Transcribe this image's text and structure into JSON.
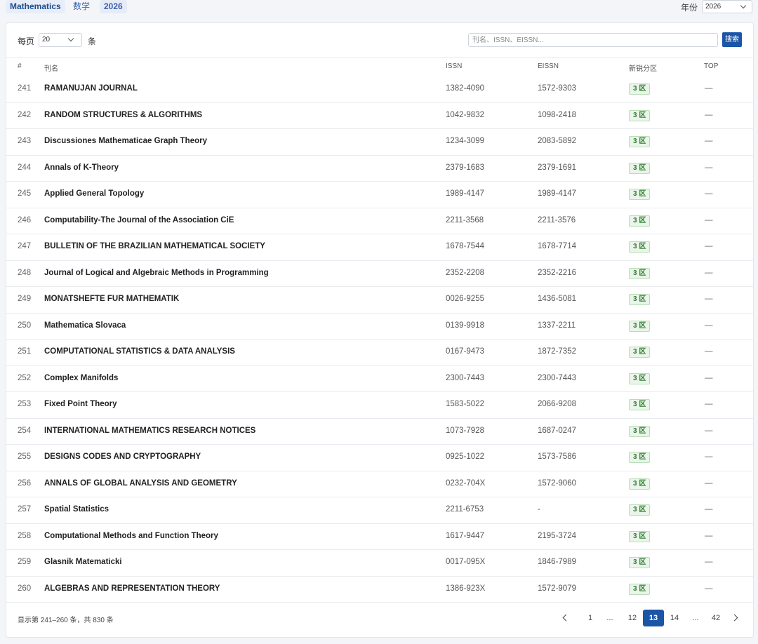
{
  "tags": [
    "Mathematics",
    "数学",
    "2026"
  ],
  "year": {
    "label": "年份",
    "selected": "2026"
  },
  "perpage": {
    "prefix": "每页",
    "value": "20",
    "suffix": "条"
  },
  "search": {
    "placeholder": "刊名、ISSN、EISSN...",
    "button": "搜索"
  },
  "columns": {
    "num": "#",
    "name": "刊名",
    "issn": "ISSN",
    "eissn": "EISSN",
    "zone": "新锐分区",
    "top": "TOP"
  },
  "rows": [
    {
      "num": "241",
      "name": "RAMANUJAN JOURNAL",
      "issn": "1382-4090",
      "eissn": "1572-9303",
      "zone": "3 区",
      "top": "—"
    },
    {
      "num": "242",
      "name": "RANDOM STRUCTURES & ALGORITHMS",
      "issn": "1042-9832",
      "eissn": "1098-2418",
      "zone": "3 区",
      "top": "—"
    },
    {
      "num": "243",
      "name": "Discussiones Mathematicae Graph Theory",
      "issn": "1234-3099",
      "eissn": "2083-5892",
      "zone": "3 区",
      "top": "—"
    },
    {
      "num": "244",
      "name": "Annals of K-Theory",
      "issn": "2379-1683",
      "eissn": "2379-1691",
      "zone": "3 区",
      "top": "—"
    },
    {
      "num": "245",
      "name": "Applied General Topology",
      "issn": "1989-4147",
      "eissn": "1989-4147",
      "zone": "3 区",
      "top": "—"
    },
    {
      "num": "246",
      "name": "Computability-The Journal of the Association CiE",
      "issn": "2211-3568",
      "eissn": "2211-3576",
      "zone": "3 区",
      "top": "—"
    },
    {
      "num": "247",
      "name": "BULLETIN OF THE BRAZILIAN MATHEMATICAL SOCIETY",
      "issn": "1678-7544",
      "eissn": "1678-7714",
      "zone": "3 区",
      "top": "—"
    },
    {
      "num": "248",
      "name": "Journal of Logical and Algebraic Methods in Programming",
      "issn": "2352-2208",
      "eissn": "2352-2216",
      "zone": "3 区",
      "top": "—"
    },
    {
      "num": "249",
      "name": "MONATSHEFTE FUR MATHEMATIK",
      "issn": "0026-9255",
      "eissn": "1436-5081",
      "zone": "3 区",
      "top": "—"
    },
    {
      "num": "250",
      "name": "Mathematica Slovaca",
      "issn": "0139-9918",
      "eissn": "1337-2211",
      "zone": "3 区",
      "top": "—"
    },
    {
      "num": "251",
      "name": "COMPUTATIONAL STATISTICS & DATA ANALYSIS",
      "issn": "0167-9473",
      "eissn": "1872-7352",
      "zone": "3 区",
      "top": "—"
    },
    {
      "num": "252",
      "name": "Complex Manifolds",
      "issn": "2300-7443",
      "eissn": "2300-7443",
      "zone": "3 区",
      "top": "—"
    },
    {
      "num": "253",
      "name": "Fixed Point Theory",
      "issn": "1583-5022",
      "eissn": "2066-9208",
      "zone": "3 区",
      "top": "—"
    },
    {
      "num": "254",
      "name": "INTERNATIONAL MATHEMATICS RESEARCH NOTICES",
      "issn": "1073-7928",
      "eissn": "1687-0247",
      "zone": "3 区",
      "top": "—"
    },
    {
      "num": "255",
      "name": "DESIGNS CODES AND CRYPTOGRAPHY",
      "issn": "0925-1022",
      "eissn": "1573-7586",
      "zone": "3 区",
      "top": "—"
    },
    {
      "num": "256",
      "name": "ANNALS OF GLOBAL ANALYSIS AND GEOMETRY",
      "issn": "0232-704X",
      "eissn": "1572-9060",
      "zone": "3 区",
      "top": "—"
    },
    {
      "num": "257",
      "name": "Spatial Statistics",
      "issn": "2211-6753",
      "eissn": "-",
      "zone": "3 区",
      "top": "—"
    },
    {
      "num": "258",
      "name": "Computational Methods and Function Theory",
      "issn": "1617-9447",
      "eissn": "2195-3724",
      "zone": "3 区",
      "top": "—"
    },
    {
      "num": "259",
      "name": "Glasnik Matematicki",
      "issn": "0017-095X",
      "eissn": "1846-7989",
      "zone": "3 区",
      "top": "—"
    },
    {
      "num": "260",
      "name": "ALGEBRAS AND REPRESENTATION THEORY",
      "issn": "1386-923X",
      "eissn": "1572-9079",
      "zone": "3 区",
      "top": "—"
    }
  ],
  "summary": "显示第 241–260 条，共 830 条",
  "pagination": {
    "pages": [
      "1",
      "...",
      "12",
      "13",
      "14",
      "...",
      "42"
    ],
    "current": "13"
  },
  "colors": {
    "accent": "#1b55a6",
    "zone_bg": "#eaf5ea",
    "zone_text": "#2f7a2f"
  }
}
